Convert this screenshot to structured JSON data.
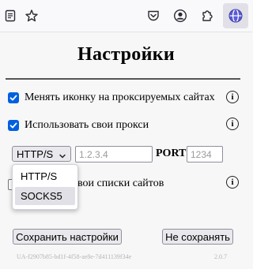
{
  "toolbar": {
    "icons": [
      "reader-mode-icon",
      "bookmark-star-icon",
      "pocket-icon",
      "account-icon",
      "extensions-icon",
      "proxy-extension-icon"
    ]
  },
  "settings": {
    "title": "Настройки",
    "option_change_icon": {
      "label": "Менять иконку на проксируемых сайтах",
      "checked": true
    },
    "option_own_proxy": {
      "label": "Использовать свои прокси",
      "checked": true
    },
    "proxy": {
      "protocol_selected": "HTTP/S",
      "protocol_options": [
        "HTTP/S",
        "SOCKS5"
      ],
      "host_placeholder": "1.2.3.4",
      "port_label": "PORT",
      "port_placeholder": "1234"
    },
    "option_own_lists": {
      "label_visible": "вои списки сайтов",
      "checked": false
    },
    "save_button": "Сохранить настройки",
    "dont_save_button": "Не сохранять",
    "footer_id": "UA-f2907b85-bd1f-4f58-ae8e-7d411139f34e",
    "version": "2.0.7"
  },
  "colors": {
    "accent": "#0060df",
    "background": "#f7f7f7"
  }
}
